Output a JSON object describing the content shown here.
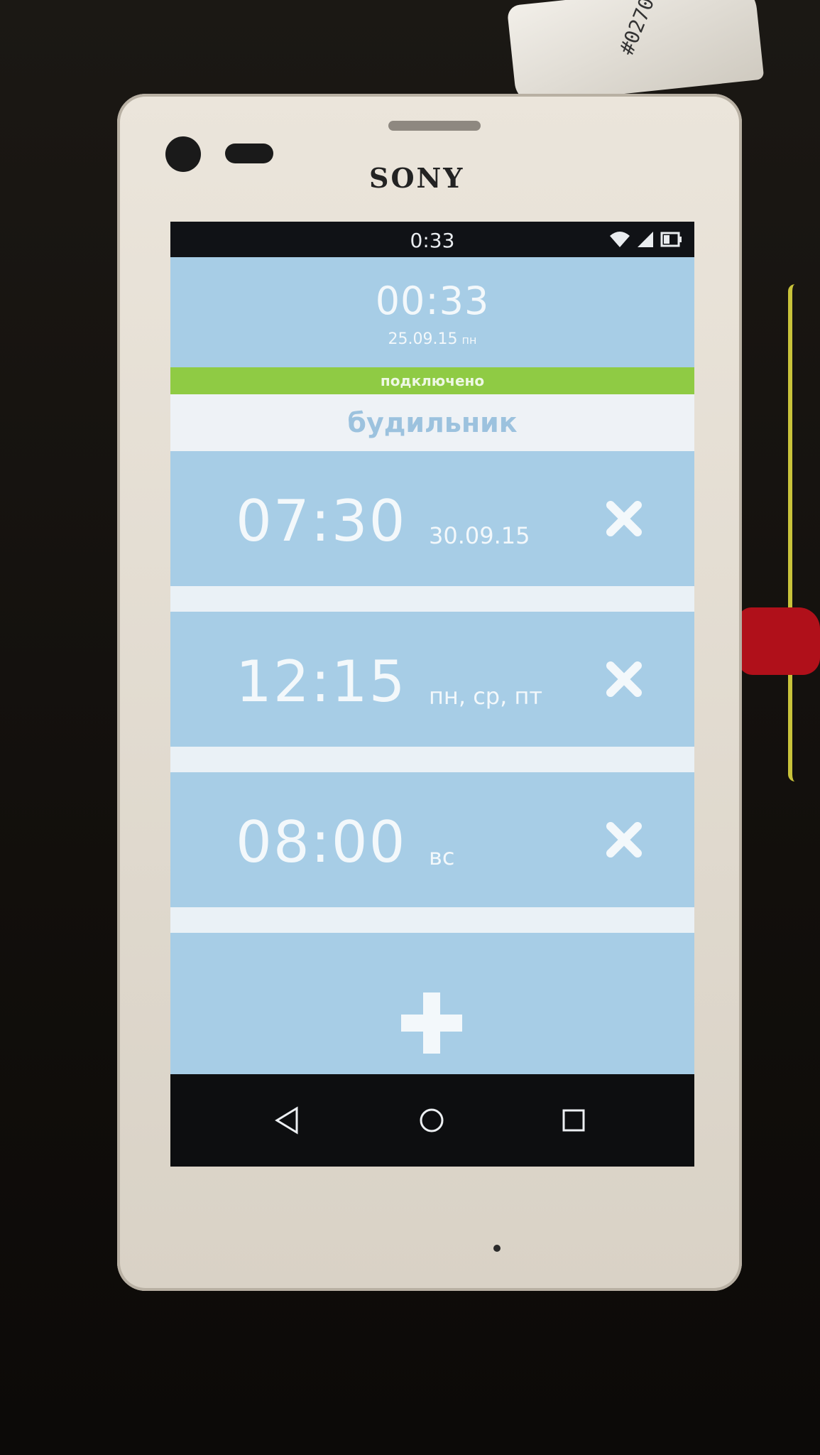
{
  "device": {
    "brand": "SONY"
  },
  "paper_scrap": {
    "text": "#0270"
  },
  "status_bar": {
    "time": "0:33"
  },
  "clock": {
    "time": "00:33",
    "date": "25.09.15",
    "weekday": "пн"
  },
  "connection": {
    "label": "подключено",
    "color": "#8fcb44"
  },
  "section": {
    "title": "будильник"
  },
  "alarms": [
    {
      "time": "07:30",
      "detail": "30.09.15"
    },
    {
      "time": "12:15",
      "detail": "пн, ср, пт"
    },
    {
      "time": "08:00",
      "detail": "вс"
    }
  ],
  "icons": {
    "remove": "close-icon",
    "add": "plus-icon",
    "back": "back-triangle-icon",
    "home": "home-circle-icon",
    "recents": "recents-square-icon"
  },
  "colors": {
    "app_background": "#a7cde6",
    "header_background": "#eef2f6",
    "header_text": "#9cc2de",
    "separator": "#eaf1f6"
  }
}
